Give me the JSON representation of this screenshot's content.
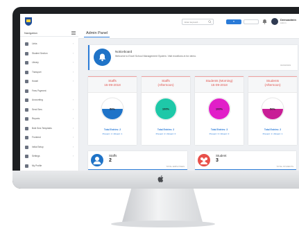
{
  "topbar": {
    "search_placeholder": "Enter keyword...",
    "button_label": "▼",
    "user_name": "Demoadmin",
    "user_role": "Admin"
  },
  "sidebar": {
    "title": "Navigation",
    "items": [
      {
        "label": "Links",
        "icon": "links-icon"
      },
      {
        "label": "Student Section",
        "icon": "student-icon"
      },
      {
        "label": "Library",
        "icon": "library-icon"
      },
      {
        "label": "Transport",
        "icon": "transport-icon"
      },
      {
        "label": "Hostel",
        "icon": "hostel-icon"
      },
      {
        "label": "Fees Payment",
        "icon": "fees-icon"
      },
      {
        "label": "Accounting",
        "icon": "accounting-icon"
      },
      {
        "label": "Send Sms",
        "icon": "sms-icon"
      },
      {
        "label": "Reports",
        "icon": "reports-icon"
      },
      {
        "label": "Bulk Sms Templates",
        "icon": "templates-icon"
      },
      {
        "label": "Frontend",
        "icon": "frontend-icon"
      },
      {
        "label": "Initial Setup",
        "icon": "setup-icon"
      },
      {
        "label": "Settings",
        "icon": "settings-icon"
      },
      {
        "label": "My Profile",
        "icon": "profile-icon"
      }
    ]
  },
  "main": {
    "tab": "Admin Panel",
    "notice": {
      "title": "Noticeboard",
      "text": "Welcome to Excel School Management System. Visit excellons.in for demo.",
      "date": "01/03/2019"
    },
    "cards": [
      {
        "title": "Staffs",
        "date": "15-09-2018",
        "percent": 50,
        "percent_label": "50%",
        "color": "#1e73c8",
        "total": "Total Entries: 2",
        "split": "Present: 1 / Absent: 1"
      },
      {
        "title": "Staffs",
        "date": "(Afternoon)",
        "percent": 100,
        "percent_label": "100%",
        "color": "#1ec8a8",
        "total": "Total Entries: 2",
        "split": "Present: 2 / Absent: 0"
      },
      {
        "title": "Students (Morning)",
        "date": "15-09-2018",
        "percent": 100,
        "percent_label": "100%",
        "color": "#e11fc8",
        "total": "Total Entries: 3",
        "split": "Present: 3 / Absent: 0"
      },
      {
        "title": "Students",
        "date": "(Afternoon)",
        "percent": 50,
        "percent_label": "50%",
        "color": "#c81e96",
        "total": "Total Entries: 2",
        "split": "Present: 1 / Absent: 1"
      }
    ],
    "stats": [
      {
        "label": "Staffs",
        "value": "2",
        "sub": "TOTAL EMPLOYEES",
        "color": "#1f73c7"
      },
      {
        "label": "Student",
        "value": "3",
        "sub": "TOTAL STUDENTS",
        "color": "#e8504a"
      }
    ]
  }
}
